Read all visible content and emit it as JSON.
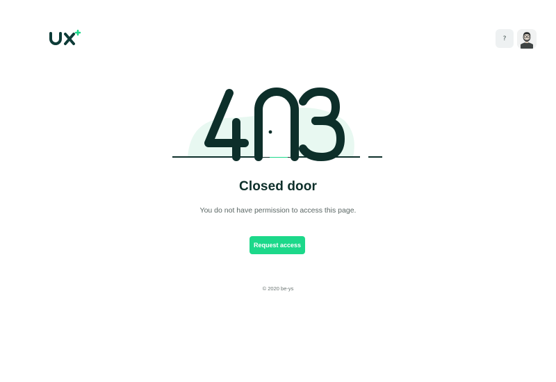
{
  "header": {
    "logo_alt": "ux",
    "help_label": "?"
  },
  "error": {
    "code": "403",
    "title": "Closed door",
    "message": "You do not have permission to access this page.",
    "button_label": "Request access"
  },
  "footer": {
    "copyright": "© 2020 be-ys"
  },
  "colors": {
    "primary_dark": "#0d2f2a",
    "accent_green": "#1cd88a",
    "mint_background": "#e6faf1"
  }
}
